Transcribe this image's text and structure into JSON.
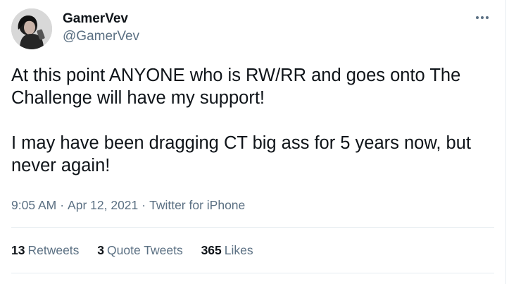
{
  "author": {
    "display_name": "GamerVev",
    "handle": "@GamerVev",
    "avatar_icon": "profile-photo"
  },
  "tweet": {
    "paragraphs": [
      "At this point ANYONE who is RW/RR and goes onto The Challenge will have my support!",
      "I may have been dragging CT big ass for 5 years now, but never again!"
    ],
    "time": "9:05 AM",
    "separator": "·",
    "date": "Apr 12, 2021",
    "source": "Twitter for iPhone"
  },
  "stats": {
    "retweets": {
      "count": "13",
      "label": "Retweets"
    },
    "quote_tweets": {
      "count": "3",
      "label": "Quote Tweets"
    },
    "likes": {
      "count": "365",
      "label": "Likes"
    }
  },
  "icons": {
    "more": "more-options-icon"
  },
  "colors": {
    "text_primary": "#0f1419",
    "text_secondary": "#5b7083",
    "divider": "#e6ecf0"
  }
}
